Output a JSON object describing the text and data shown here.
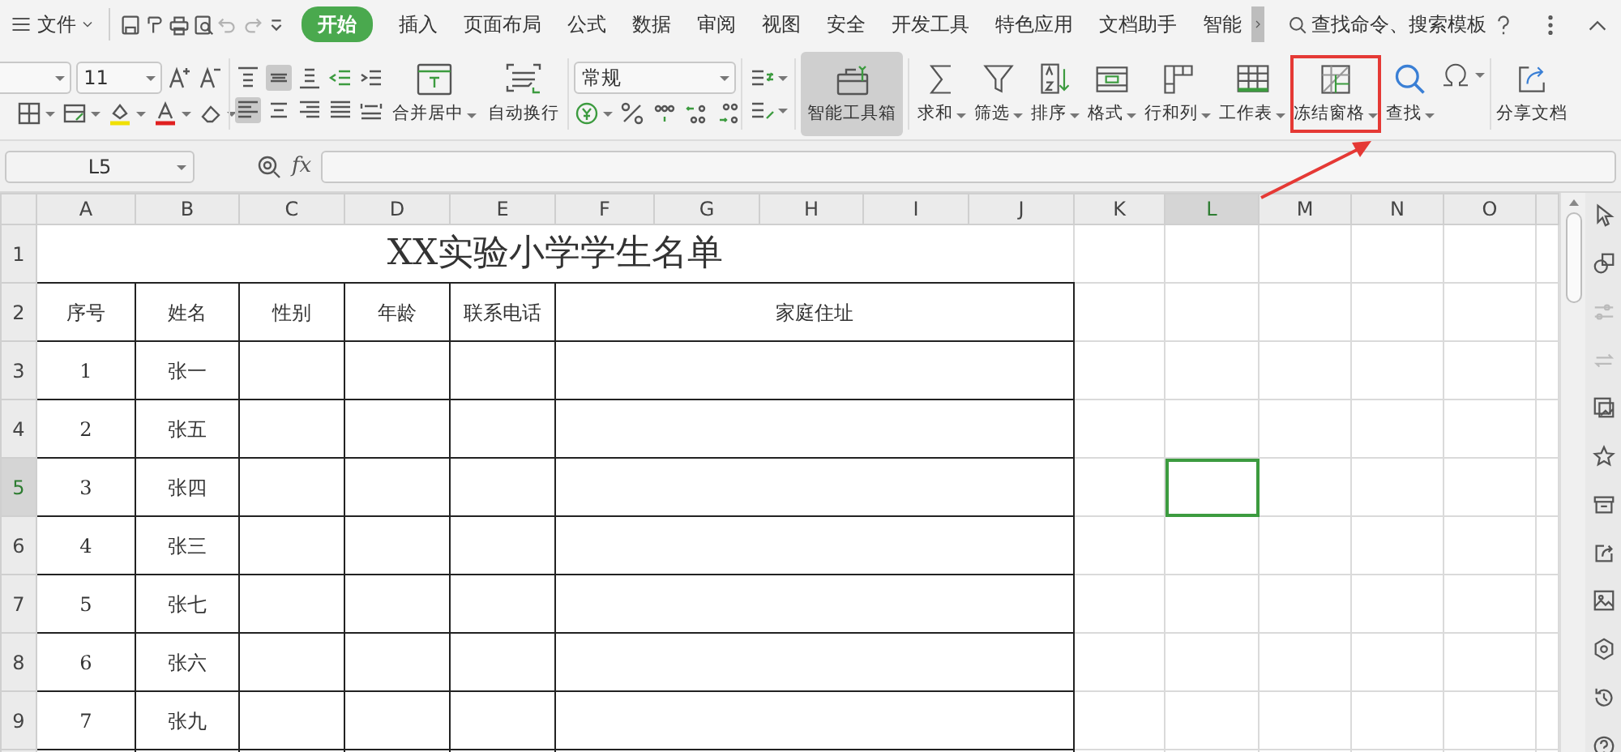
{
  "menu_bar": {
    "file_label": "文件",
    "quick_access": [
      {
        "kind": "save",
        "disabled": false
      },
      {
        "kind": "painter",
        "disabled": false
      },
      {
        "kind": "print",
        "disabled": false
      },
      {
        "kind": "preview",
        "disabled": false
      },
      {
        "kind": "undo",
        "disabled": true
      },
      {
        "kind": "redo",
        "disabled": true
      },
      {
        "kind": "customize",
        "disabled": false
      }
    ],
    "tabs": [
      {
        "label": "开始",
        "selected": true
      },
      {
        "label": "插入",
        "selected": false
      },
      {
        "label": "页面布局",
        "selected": false
      },
      {
        "label": "公式",
        "selected": false
      },
      {
        "label": "数据",
        "selected": false
      },
      {
        "label": "审阅",
        "selected": false
      },
      {
        "label": "视图",
        "selected": false
      },
      {
        "label": "安全",
        "selected": false
      },
      {
        "label": "开发工具",
        "selected": false
      },
      {
        "label": "特色应用",
        "selected": false
      },
      {
        "label": "文档助手",
        "selected": false
      },
      {
        "label": "智能",
        "selected": false
      }
    ],
    "search": {
      "placeholder": "查找命令、搜索模板"
    }
  },
  "ribbon": {
    "font_size": "11",
    "merge_label": "合并居中",
    "wrap_label": "自动换行",
    "number_format": "常规",
    "toolbox_label": "智能工具箱",
    "commands": [
      {
        "label": "求和",
        "kind": "sum",
        "highlighted": false
      },
      {
        "label": "筛选",
        "kind": "filter",
        "highlighted": false
      },
      {
        "label": "排序",
        "kind": "sort",
        "highlighted": false
      },
      {
        "label": "格式",
        "kind": "format",
        "highlighted": false
      },
      {
        "label": "行和列",
        "kind": "rowcol",
        "highlighted": false
      },
      {
        "label": "工作表",
        "kind": "sheet",
        "highlighted": false
      },
      {
        "label": "冻结窗格",
        "kind": "freeze",
        "highlighted": true
      },
      {
        "label": "查找",
        "kind": "find",
        "highlighted": false
      }
    ],
    "share_label": "分享文档"
  },
  "formula_bar": {
    "cell_ref": "L5",
    "fx_label": "fx"
  },
  "sheet": {
    "columns": [
      {
        "label": "A",
        "selected": false
      },
      {
        "label": "B",
        "selected": false
      },
      {
        "label": "C",
        "selected": false
      },
      {
        "label": "D",
        "selected": false
      },
      {
        "label": "E",
        "selected": false
      },
      {
        "label": "F",
        "selected": false
      },
      {
        "label": "G",
        "selected": false
      },
      {
        "label": "H",
        "selected": false
      },
      {
        "label": "I",
        "selected": false
      },
      {
        "label": "J",
        "selected": false
      },
      {
        "label": "K",
        "selected": false
      },
      {
        "label": "L",
        "selected": true
      },
      {
        "label": "M",
        "selected": false
      },
      {
        "label": "N",
        "selected": false
      },
      {
        "label": "O",
        "selected": false
      }
    ],
    "rows": [
      {
        "label": "1",
        "selected": false
      },
      {
        "label": "2",
        "selected": false
      },
      {
        "label": "3",
        "selected": false
      },
      {
        "label": "4",
        "selected": false
      },
      {
        "label": "5",
        "selected": true
      },
      {
        "label": "6",
        "selected": false
      },
      {
        "label": "7",
        "selected": false
      },
      {
        "label": "8",
        "selected": false
      },
      {
        "label": "9",
        "selected": false
      }
    ],
    "title": "XX实验小学学生名单",
    "headers": [
      "序号",
      "姓名",
      "性别",
      "年龄",
      "联系电话",
      "家庭住址"
    ],
    "records": [
      {
        "number": "1",
        "name": "张一"
      },
      {
        "number": "2",
        "name": "张五"
      },
      {
        "number": "3",
        "name": "张四"
      },
      {
        "number": "4",
        "name": "张三"
      },
      {
        "number": "5",
        "name": "张七"
      },
      {
        "number": "6",
        "name": "张六"
      },
      {
        "number": "7",
        "name": "张九"
      }
    ]
  },
  "side_panel": [
    {
      "kind": "cursor",
      "disabled": false
    },
    {
      "kind": "shapes",
      "disabled": false
    },
    {
      "kind": "sliders",
      "disabled": true
    },
    {
      "kind": "swap",
      "disabled": true
    },
    {
      "kind": "gallery",
      "disabled": false
    },
    {
      "kind": "star",
      "disabled": false
    },
    {
      "kind": "archive",
      "disabled": false
    },
    {
      "kind": "share",
      "disabled": false
    },
    {
      "kind": "image",
      "disabled": false
    },
    {
      "kind": "hexagon",
      "disabled": false
    },
    {
      "kind": "history",
      "disabled": false
    },
    {
      "kind": "help",
      "disabled": false
    }
  ]
}
